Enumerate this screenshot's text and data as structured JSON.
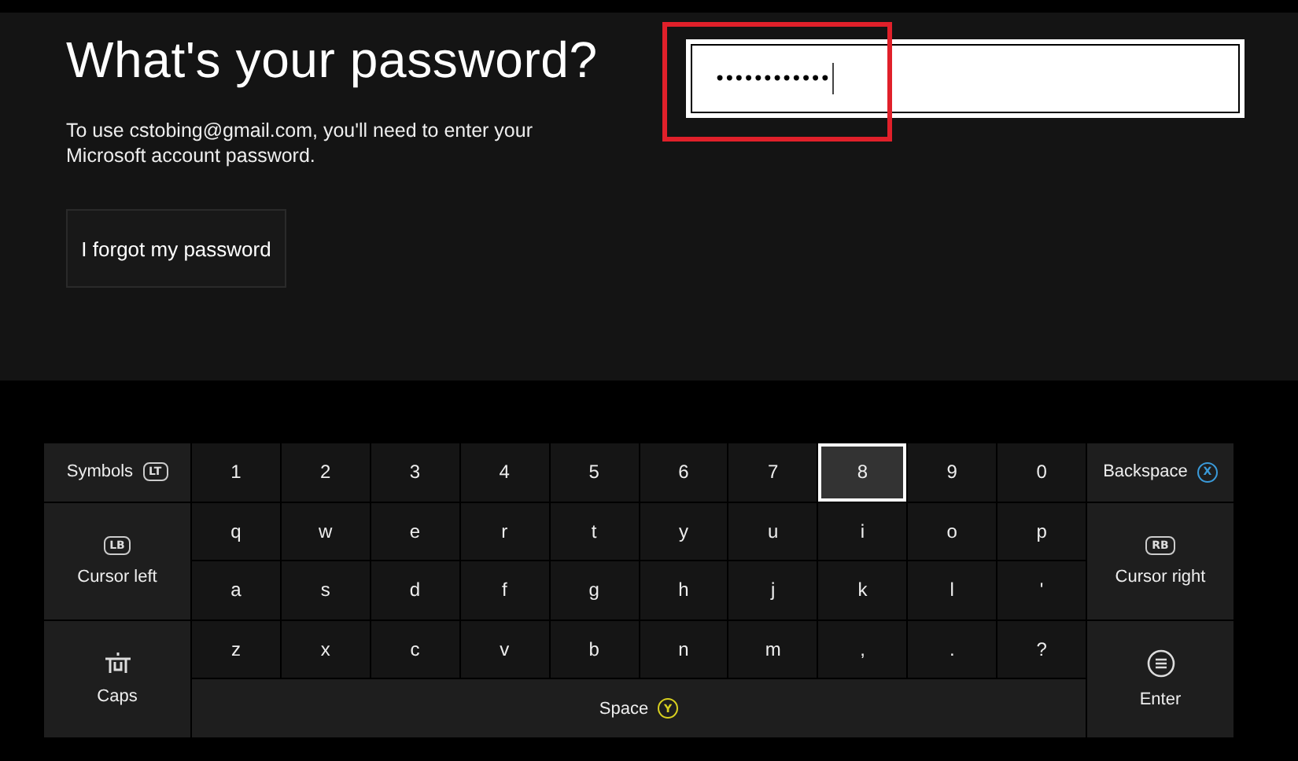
{
  "heading": "What's your password?",
  "description": "To use cstobing@gmail.com, you'll need to enter your Microsoft account password.",
  "forgot_button": "I forgot my password",
  "password_field": {
    "value": "••••••••••••",
    "highlighted": true
  },
  "keyboard": {
    "side_left": [
      {
        "kind": "symbols",
        "label": "Symbols",
        "hint": "LT"
      },
      {
        "kind": "cursor",
        "label": "Cursor left",
        "hint": "LB"
      },
      {
        "kind": "caps",
        "label": "Caps"
      }
    ],
    "side_right": [
      {
        "kind": "backspace",
        "label": "Backspace",
        "hint": "X"
      },
      {
        "kind": "cursor",
        "label": "Cursor right",
        "hint": "RB"
      },
      {
        "kind": "enter",
        "label": "Enter"
      }
    ],
    "rows": [
      [
        {
          "label": "1",
          "selected": false
        },
        {
          "label": "2",
          "selected": false
        },
        {
          "label": "3",
          "selected": false
        },
        {
          "label": "4",
          "selected": false
        },
        {
          "label": "5",
          "selected": false
        },
        {
          "label": "6",
          "selected": false
        },
        {
          "label": "7",
          "selected": false
        },
        {
          "label": "8",
          "selected": true
        },
        {
          "label": "9",
          "selected": false
        },
        {
          "label": "0",
          "selected": false
        }
      ],
      [
        {
          "label": "q",
          "selected": false
        },
        {
          "label": "w",
          "selected": false
        },
        {
          "label": "e",
          "selected": false
        },
        {
          "label": "r",
          "selected": false
        },
        {
          "label": "t",
          "selected": false
        },
        {
          "label": "y",
          "selected": false
        },
        {
          "label": "u",
          "selected": false
        },
        {
          "label": "i",
          "selected": false
        },
        {
          "label": "o",
          "selected": false
        },
        {
          "label": "p",
          "selected": false
        }
      ],
      [
        {
          "label": "a",
          "selected": false
        },
        {
          "label": "s",
          "selected": false
        },
        {
          "label": "d",
          "selected": false
        },
        {
          "label": "f",
          "selected": false
        },
        {
          "label": "g",
          "selected": false
        },
        {
          "label": "h",
          "selected": false
        },
        {
          "label": "j",
          "selected": false
        },
        {
          "label": "k",
          "selected": false
        },
        {
          "label": "l",
          "selected": false
        },
        {
          "label": "'",
          "selected": false
        }
      ],
      [
        {
          "label": "z",
          "selected": false
        },
        {
          "label": "x",
          "selected": false
        },
        {
          "label": "c",
          "selected": false
        },
        {
          "label": "v",
          "selected": false
        },
        {
          "label": "b",
          "selected": false
        },
        {
          "label": "n",
          "selected": false
        },
        {
          "label": "m",
          "selected": false
        },
        {
          "label": ",",
          "selected": false
        },
        {
          "label": ".",
          "selected": false
        },
        {
          "label": "?",
          "selected": false
        }
      ]
    ],
    "space": {
      "label": "Space",
      "hint": "Y"
    }
  }
}
